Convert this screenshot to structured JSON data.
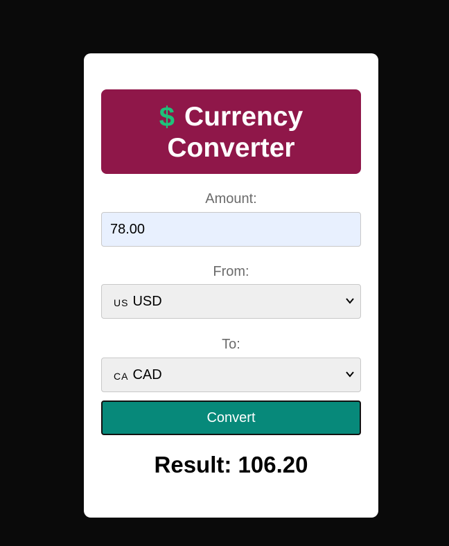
{
  "header": {
    "icon": "dollar-icon",
    "icon_glyph": "$",
    "icon_color": "#1ec27a",
    "title_line1": "Currency",
    "title_line2": "Converter",
    "banner_color": "#8f1749"
  },
  "amount": {
    "label": "Amount:",
    "value": "78.00"
  },
  "from": {
    "label": "From:",
    "flag": "US",
    "selected": "USD"
  },
  "to": {
    "label": "To:",
    "flag": "CA",
    "selected": "CAD"
  },
  "convert_button": {
    "label": "Convert",
    "color": "#07897a"
  },
  "result": {
    "text": "Result: 106.20"
  }
}
